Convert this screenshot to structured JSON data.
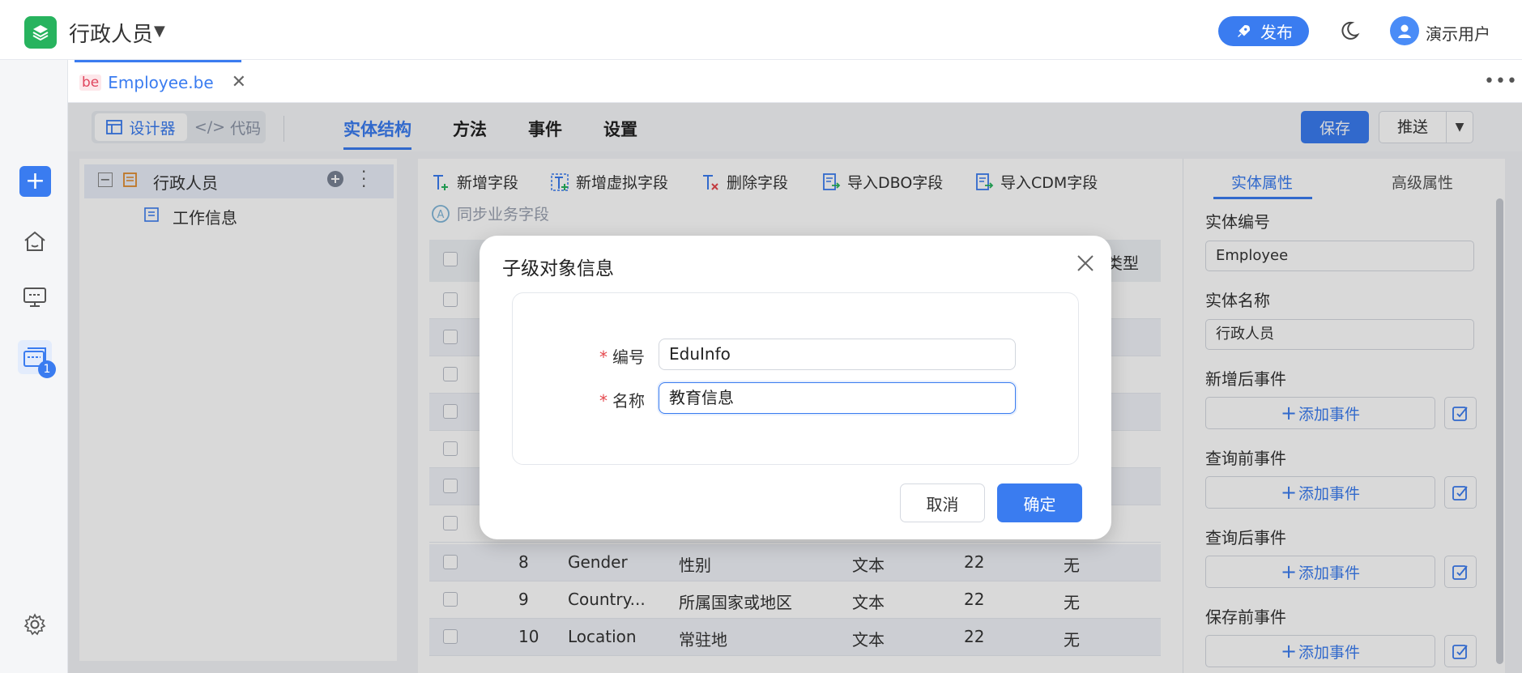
{
  "header": {
    "app_title": "行政人员",
    "publish_label": "发布",
    "user_name": "演示用户"
  },
  "rail": {
    "badge_count": "1"
  },
  "file_tab": {
    "badge": "be",
    "name": "Employee.be"
  },
  "toolbar": {
    "designer_label": "设计器",
    "code_label": "代码",
    "tabs": [
      "实体结构",
      "方法",
      "事件",
      "设置"
    ],
    "save_label": "保存",
    "push_label": "推送"
  },
  "tree": {
    "root": "行政人员",
    "child": "工作信息"
  },
  "grid": {
    "actions": [
      "新增字段",
      "新增虚拟字段",
      "删除字段",
      "导入DBO字段",
      "导入CDM字段"
    ],
    "sync_label": "同步业务字段",
    "header_partial": "类型",
    "rows": [
      {
        "no": "8",
        "code": "Gender",
        "name": "性别",
        "type": "文本",
        "len": "22",
        "extra": "无"
      },
      {
        "no": "9",
        "code": "Country...",
        "name": "所属国家或地区",
        "type": "文本",
        "len": "22",
        "extra": "无"
      },
      {
        "no": "10",
        "code": "Location",
        "name": "常驻地",
        "type": "文本",
        "len": "22",
        "extra": "无"
      }
    ]
  },
  "right_panel": {
    "tabs": [
      "实体属性",
      "高级属性"
    ],
    "entity_code_label": "实体编号",
    "entity_code": "Employee",
    "entity_name_label": "实体名称",
    "entity_name": "行政人员",
    "events": [
      "新增后事件",
      "查询前事件",
      "查询后事件",
      "保存前事件"
    ],
    "add_event_label": "添加事件"
  },
  "dialog": {
    "title": "子级对象信息",
    "code_label": "编号",
    "code_value": "EduInfo",
    "name_label": "名称",
    "name_value": "教育信息",
    "cancel_label": "取消",
    "ok_label": "确定"
  },
  "colors": {
    "accent": "#3a7cf0",
    "brand_green": "#27b35e",
    "required": "#e5484d"
  }
}
